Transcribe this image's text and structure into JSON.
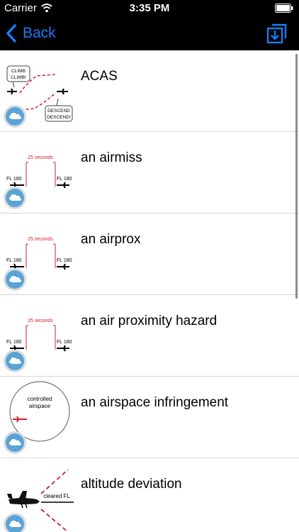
{
  "status_bar": {
    "carrier": "Carrier",
    "time": "3:35 PM"
  },
  "nav": {
    "back_label": "Back",
    "accent_color": "#1a7cf5"
  },
  "entries": [
    {
      "term": "ACAS",
      "illustration": {
        "bubble_top": [
          "CLIMB",
          "CLIMB!"
        ],
        "bubble_bottom": [
          "DESCEND",
          "DESCEND!"
        ]
      }
    },
    {
      "term": "an airmiss",
      "illustration": {
        "interval": "25 seconds",
        "level_left": "FL 180",
        "level_right": "FL 180"
      }
    },
    {
      "term": "an airprox",
      "illustration": {
        "interval": "25 seconds",
        "level_left": "FL 180",
        "level_right": "FL 180"
      }
    },
    {
      "term": "an air proximity hazard",
      "illustration": {
        "interval": "25 seconds",
        "level_left": "FL 180",
        "level_right": "FL 180"
      }
    },
    {
      "term": "an airspace infringement",
      "illustration": {
        "zone_line1": "controlled",
        "zone_line2": "airspace"
      }
    },
    {
      "term": "altitude deviation",
      "illustration": {
        "level_label": "cleared FL"
      }
    }
  ]
}
